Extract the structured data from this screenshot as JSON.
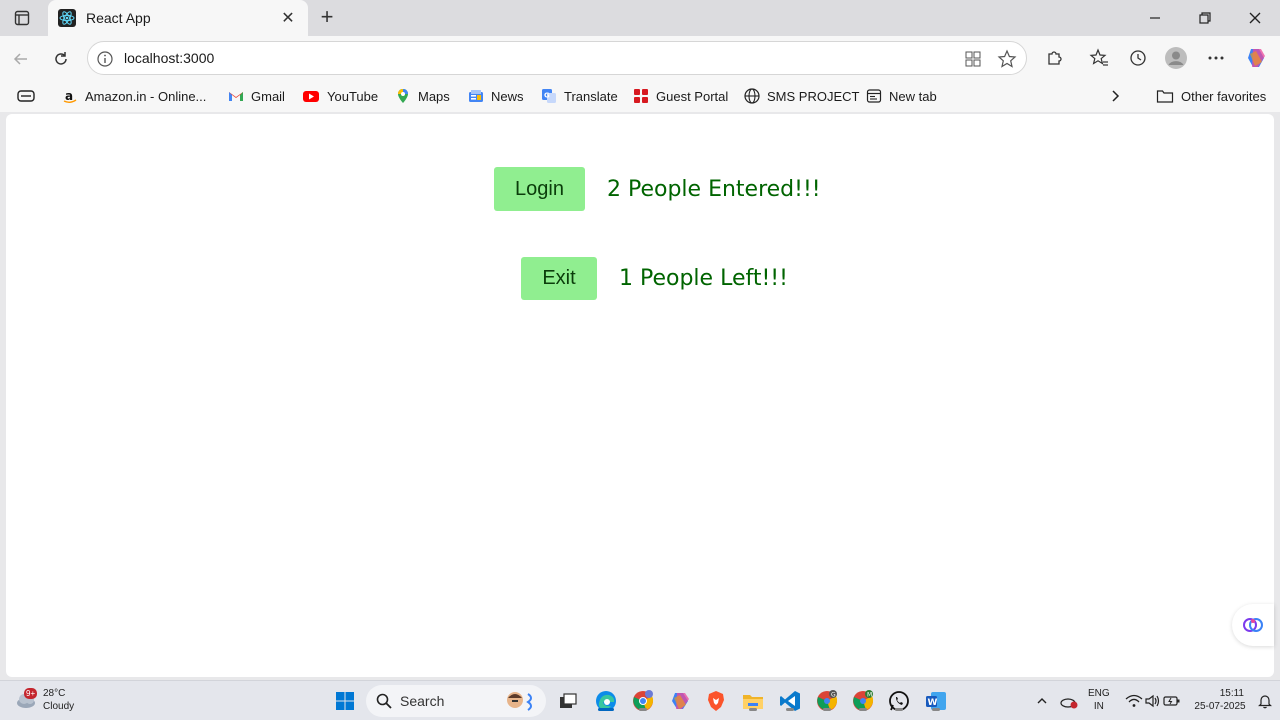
{
  "browser": {
    "tab_title": "React App",
    "url": "localhost:3000",
    "favorites": [
      {
        "label": "Amazon.in - Online...",
        "icon": "amazon-icon"
      },
      {
        "label": "Gmail",
        "icon": "gmail-icon"
      },
      {
        "label": "YouTube",
        "icon": "youtube-icon"
      },
      {
        "label": "Maps",
        "icon": "maps-icon"
      },
      {
        "label": "News",
        "icon": "news-icon"
      },
      {
        "label": "Translate",
        "icon": "translate-icon"
      },
      {
        "label": "Guest Portal",
        "icon": "portal-icon"
      },
      {
        "label": "SMS PROJECT",
        "icon": "globe-icon"
      },
      {
        "label": "New tab",
        "icon": "newtab-icon"
      }
    ],
    "other_favorites": "Other favorites"
  },
  "app": {
    "login_label": "Login",
    "entered_text": "2 People Entered!!!",
    "exit_label": "Exit",
    "left_text": "1 People Left!!!",
    "button_color": "#90ee90",
    "text_color": "#006400"
  },
  "taskbar": {
    "weather_temp": "28°C",
    "weather_desc": "Cloudy",
    "weather_badge": "9+",
    "search_placeholder": "Search",
    "lang_top": "ENG",
    "lang_bottom": "IN",
    "time": "15:11",
    "date": "25-07-2025"
  }
}
